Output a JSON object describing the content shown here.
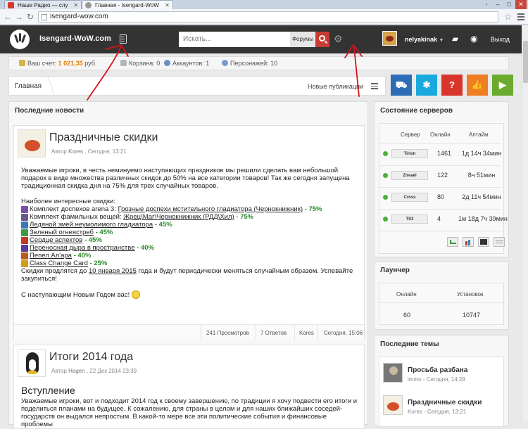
{
  "browser": {
    "tabs": [
      {
        "title": "Наше Радио — слу",
        "active": false
      },
      {
        "title": "Главная - Isengard-WoW",
        "active": true
      }
    ],
    "url": "isengard-wow.com"
  },
  "header": {
    "brand": "Isengard-WoW.com",
    "search_placeholder": "Искать...",
    "search_scope": "Форумы",
    "username": "nelyakinak",
    "logout": "Выход"
  },
  "account": {
    "balance_label": "Ваш счет:",
    "balance_value": "1 021,35",
    "balance_currency": "руб.",
    "cart": "Корзина: 0",
    "accounts": "Аккаунтов: 1",
    "characters": "Персонажей: 10"
  },
  "breadcrumb": {
    "home": "Главная",
    "new_posts": "Новые публикации"
  },
  "quick_buttons": [
    {
      "icon": "cart-icon",
      "color": "#2c6db5"
    },
    {
      "icon": "gear-icon",
      "color": "#1aa9de"
    },
    {
      "icon": "help-icon",
      "color": "#d9352a"
    },
    {
      "icon": "thumbs-up-icon",
      "color": "#ef7d22"
    },
    {
      "icon": "play-icon",
      "color": "#6aab2e"
    }
  ],
  "news": {
    "section_title": "Последние новости",
    "items": [
      {
        "title": "Праздничные скидки",
        "author_label": "Автор",
        "author": "Kores",
        "date": "Сегодня, 13:21",
        "intro": "Уважаемые игроки, в честь неминуемо наступающих праздников мы решили сделать вам небольшой подарок в виде множества различных скидок до 50% на все категории товаров! Так же сегодня запущена традиционная скидка дня на 75% для трех случайных товаров.",
        "list_title": "Наиболее интересные скидки:",
        "list": [
          {
            "prefix": "Комплект доспехов arena 3: ",
            "link": "Грозные доспехи мстительного гладиатора (Чернокнижник)",
            "pct": " - 75%"
          },
          {
            "prefix": "Комплект фамильных вещей: ",
            "link": "Жрец\\Маг\\Чернокнижник (РДД\\Хил)",
            "pct": " - 75%"
          },
          {
            "prefix": "",
            "link": "Ледяной змей неумолимого гладиатора",
            "pct": " - 45%"
          },
          {
            "prefix": "",
            "link": "Зеленый огнеястреб",
            "pct": " - 45%"
          },
          {
            "prefix": "",
            "link": "Сердце аспектов",
            "pct": " - 45%"
          },
          {
            "prefix": "",
            "link": "Переносная дыра в пространстве",
            "pct": " - 40%"
          },
          {
            "prefix": "",
            "link": "Пепел Ал'ара",
            "pct": " - 40%"
          },
          {
            "prefix": "",
            "link": "Class Change Card",
            "pct": " - 25%"
          }
        ],
        "outro_a": "Скидки продлятся до ",
        "outro_date": "10 января 2015",
        "outro_b": " года и будут периодически меняться случайным образом. Успевайте закупиться!",
        "greeting": "С наступающим Новым Годом вас!",
        "views": "241 Просмотров",
        "replies": "7 Ответов",
        "last_author": "Kores",
        "last_date": "Сегодня, 15:06"
      },
      {
        "title": "Итоги 2014 года",
        "author_label": "Автор",
        "author": "Hagen",
        "date": "22 Дек 2014 23:39",
        "heading": "Вступление",
        "text": "Уважаемые игроки, вот и подходит 2014 год к своему завершению, по традиции я хочу подвести его итоги и поделиться планами на будущее. К сожалению, для страны в целом и для наших ближайших соседей-государств он выдался непростым. В какой-то мере все эти политические события и финансовые проблемы"
      }
    ]
  },
  "servers": {
    "title": "Состояние серверов",
    "columns": [
      "Сервер",
      "Онлайн",
      "Аптайм"
    ],
    "rows": [
      {
        "name": "Tirion",
        "online": "1461",
        "uptime": "1д 14ч 34мин"
      },
      {
        "name": "Zireael",
        "online": "122",
        "uptime": "8ч 51мин"
      },
      {
        "name": "Cross",
        "online": "80",
        "uptime": "2д 11ч 54мин"
      },
      {
        "name": "TS3",
        "online": "4",
        "uptime": "1м 18д 7ч 39мин"
      }
    ]
  },
  "launcher": {
    "title": "Лаунчер",
    "online_label": "Онлайн",
    "installs_label": "Установок",
    "online": "60",
    "installs": "10747"
  },
  "topics": {
    "title": "Последние темы",
    "items": [
      {
        "title": "Просьба разбана",
        "author": "immo",
        "date": "Сегодня, 14:29"
      },
      {
        "title": "Праздничные скидки",
        "author": "Kores",
        "date": "Сегодня, 13:21"
      }
    ]
  }
}
